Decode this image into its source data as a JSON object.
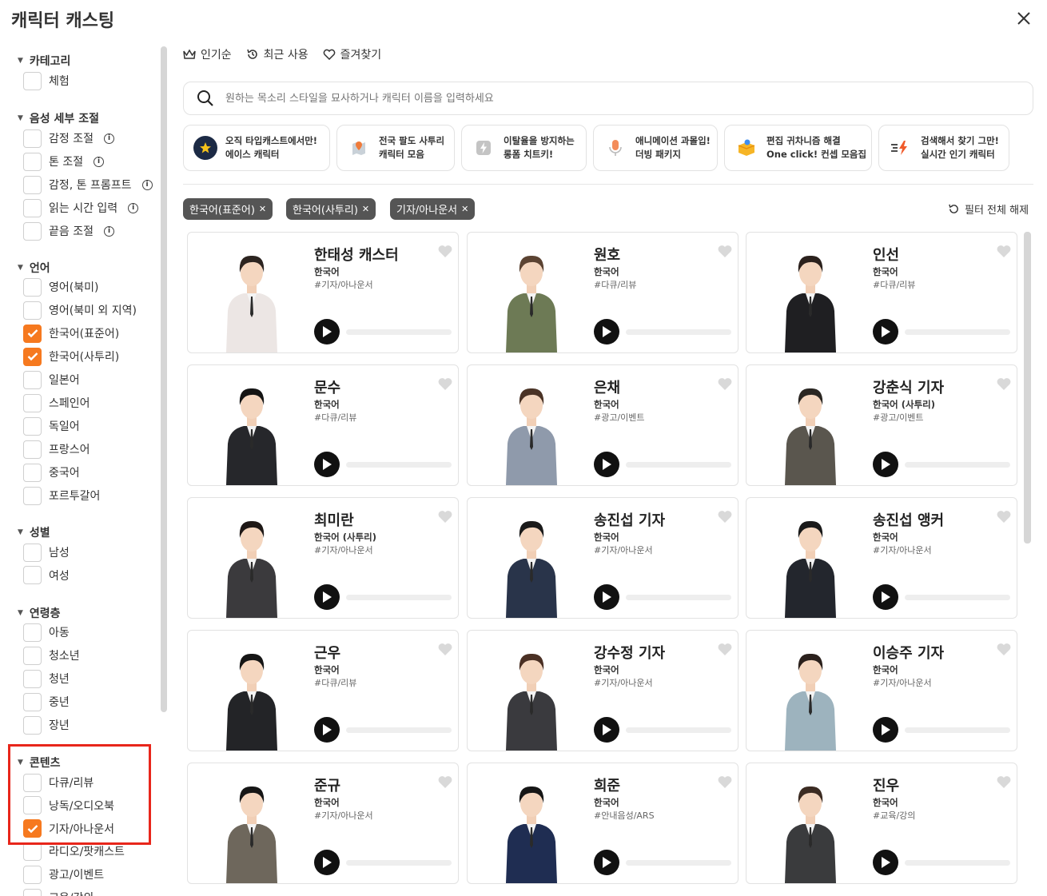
{
  "header": {
    "title": "캐릭터 캐스팅"
  },
  "sidebar": {
    "category": {
      "title": "카테고리",
      "items": [
        {
          "label": "체험",
          "checked": false
        }
      ]
    },
    "voice": {
      "title": "음성 세부 조절",
      "items": [
        {
          "label": "감정 조절",
          "checked": false,
          "info": true
        },
        {
          "label": "톤 조절",
          "checked": false,
          "info": true
        },
        {
          "label": "감정, 톤 프롬프트",
          "checked": false,
          "info": true
        },
        {
          "label": "읽는 시간 입력",
          "checked": false,
          "info": true
        },
        {
          "label": "끝음 조절",
          "checked": false,
          "info": true
        }
      ]
    },
    "language": {
      "title": "언어",
      "items": [
        {
          "label": "영어(북미)",
          "checked": false
        },
        {
          "label": "영어(북미 외 지역)",
          "checked": false
        },
        {
          "label": "한국어(표준어)",
          "checked": true
        },
        {
          "label": "한국어(사투리)",
          "checked": true
        },
        {
          "label": "일본어",
          "checked": false
        },
        {
          "label": "스페인어",
          "checked": false
        },
        {
          "label": "독일어",
          "checked": false
        },
        {
          "label": "프랑스어",
          "checked": false
        },
        {
          "label": "중국어",
          "checked": false
        },
        {
          "label": "포르투갈어",
          "checked": false
        }
      ]
    },
    "gender": {
      "title": "성별",
      "items": [
        {
          "label": "남성",
          "checked": false
        },
        {
          "label": "여성",
          "checked": false
        }
      ]
    },
    "age": {
      "title": "연령층",
      "items": [
        {
          "label": "아동",
          "checked": false
        },
        {
          "label": "청소년",
          "checked": false
        },
        {
          "label": "청년",
          "checked": false
        },
        {
          "label": "중년",
          "checked": false
        },
        {
          "label": "장년",
          "checked": false
        }
      ]
    },
    "content": {
      "title": "콘텐츠",
      "items": [
        {
          "label": "다큐/리뷰",
          "checked": false
        },
        {
          "label": "낭독/오디오북",
          "checked": false
        },
        {
          "label": "기자/아나운서",
          "checked": true
        },
        {
          "label": "라디오/팟캐스트",
          "checked": false
        },
        {
          "label": "광고/이벤트",
          "checked": false
        },
        {
          "label": "교육/강의",
          "checked": false
        }
      ]
    }
  },
  "tabs": [
    {
      "label": "인기순",
      "icon": "crown-icon"
    },
    {
      "label": "최근 사용",
      "icon": "history-icon"
    },
    {
      "label": "즐겨찾기",
      "icon": "heart-icon"
    }
  ],
  "search": {
    "placeholder": "원하는 목소리 스타일을 묘사하거나 캐릭터 이름을 입력하세요"
  },
  "promos": [
    {
      "line1": "오직 타입캐스트에서만!",
      "line2": "에이스 캐릭터",
      "icon": "star-icon",
      "color": "#1c2a45"
    },
    {
      "line1": "전국 팔도 사투리",
      "line2": "캐릭터 모음",
      "icon": "map-pin-icon",
      "color": "#9aa8b4"
    },
    {
      "line1": "이탈율을 방지하는",
      "line2": "롱폼 치트키!",
      "icon": "lightning-icon",
      "color": "#b8b8b8"
    },
    {
      "line1": "애니메이션 과몰입!",
      "line2": "더빙 패키지",
      "icon": "microphone-icon",
      "color": "#f29b6c"
    },
    {
      "line1": "편집 귀차니즘 해결",
      "line2": "One click! 컨셉 모음집",
      "icon": "box-icon",
      "color": "#f5b92f"
    },
    {
      "line1": "검색해서 찾기 그만!",
      "line2": "실시간 인기 캐릭터",
      "icon": "trending-icon",
      "color": "#f05b2b"
    }
  ],
  "chips": [
    "한국어(표준어)",
    "한국어(사투리)",
    "기자/아나운서"
  ],
  "reset_label": "필터 전체 해제",
  "characters": [
    {
      "name": "한태성 캐스터",
      "lang": "한국어",
      "tag": "#기자/아나운서",
      "suit": "#ece6e4",
      "hair": "#2c2420"
    },
    {
      "name": "원호",
      "lang": "한국어",
      "tag": "#다큐/리뷰",
      "suit": "#6d7a55",
      "hair": "#5b4332"
    },
    {
      "name": "인선",
      "lang": "한국어",
      "tag": "#다큐/리뷰",
      "suit": "#1f1f22",
      "hair": "#2b211d"
    },
    {
      "name": "문수",
      "lang": "한국어",
      "tag": "#다큐/리뷰",
      "suit": "#26272b",
      "hair": "#141414"
    },
    {
      "name": "은채",
      "lang": "한국어",
      "tag": "#광고/이벤트",
      "suit": "#8f9aab",
      "hair": "#4a3326"
    },
    {
      "name": "강춘식 기자",
      "lang": "한국어 (사투리)",
      "tag": "#광고/이벤트",
      "suit": "#5a564e",
      "hair": "#2a2622"
    },
    {
      "name": "최미란",
      "lang": "한국어 (사투리)",
      "tag": "#기자/아나운서",
      "suit": "#3b3a3d",
      "hair": "#1e1816"
    },
    {
      "name": "송진섭 기자",
      "lang": "한국어",
      "tag": "#기자/아나운서",
      "suit": "#29344a",
      "hair": "#1a1a1a"
    },
    {
      "name": "송진섭 앵커",
      "lang": "한국어",
      "tag": "#기자/아나운서",
      "suit": "#23262d",
      "hair": "#1a1a1a"
    },
    {
      "name": "근우",
      "lang": "한국어",
      "tag": "#다큐/리뷰",
      "suit": "#232427",
      "hair": "#151515"
    },
    {
      "name": "강수정 기자",
      "lang": "한국어",
      "tag": "#기자/아나운서",
      "suit": "#3a3a3e",
      "hair": "#4a3024"
    },
    {
      "name": "이승주 기자",
      "lang": "한국어",
      "tag": "#기자/아나운서",
      "suit": "#9db3be",
      "hair": "#2b211d"
    },
    {
      "name": "준규",
      "lang": "한국어",
      "tag": "#기자/아나운서",
      "suit": "#6e675c",
      "hair": "#161616"
    },
    {
      "name": "희준",
      "lang": "한국어",
      "tag": "#안내음성/ARS",
      "suit": "#1f2d52",
      "hair": "#161616"
    },
    {
      "name": "진우",
      "lang": "한국어",
      "tag": "#교육/강의",
      "suit": "#3a3b3d",
      "hair": "#3b2b22"
    }
  ]
}
